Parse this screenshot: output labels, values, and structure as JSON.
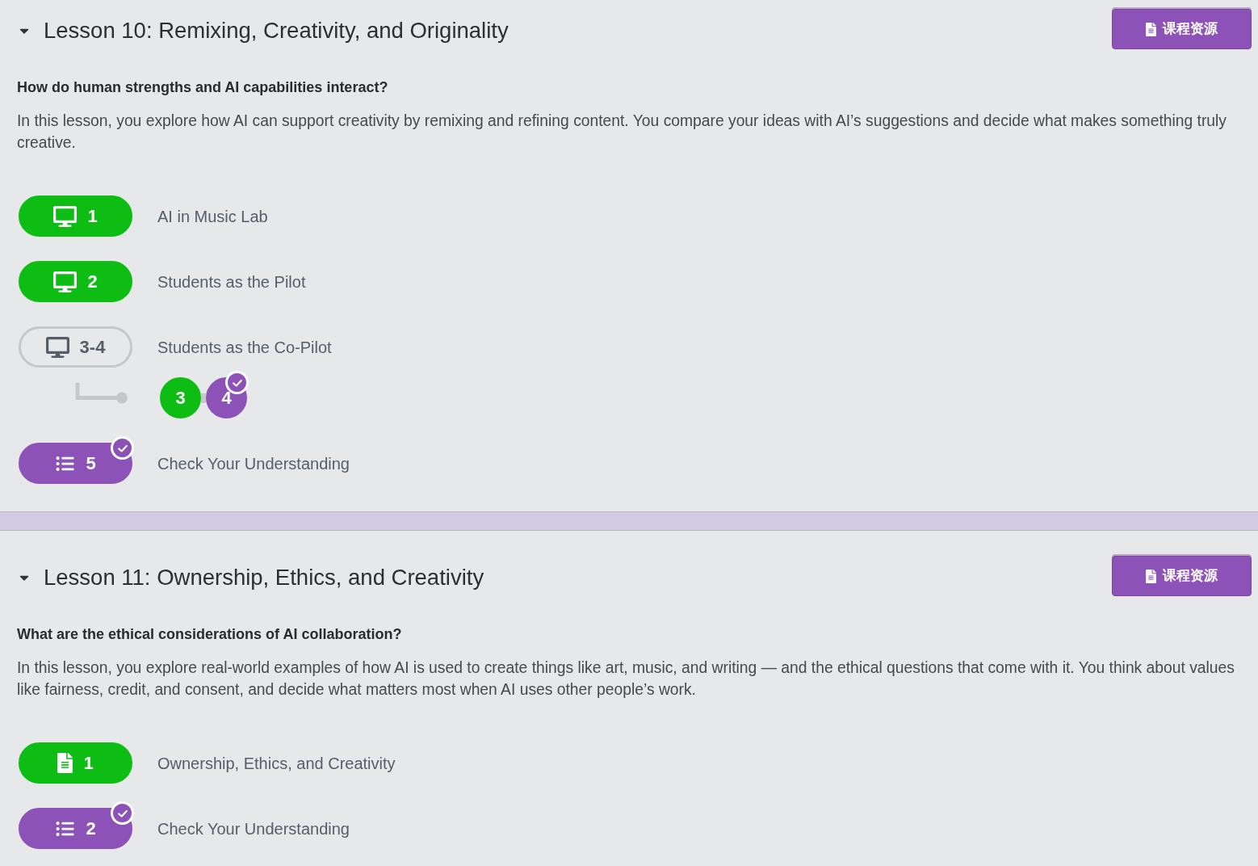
{
  "lessons": [
    {
      "title": "Lesson 10: Remixing, Creativity, and Originality",
      "expanded": true,
      "resources_button": "课程资源",
      "question": "How do human strengths and AI capabilities interact?",
      "description": "In this lesson, you explore how AI can support creativity by remixing and refining content. You compare your ideas with AI’s suggestions and decide what makes something truly creative.",
      "activities": [
        {
          "kind": "monitor",
          "label": "1",
          "title": "AI in Music Lab",
          "completed": true,
          "assessment": false,
          "checked": false
        },
        {
          "kind": "monitor",
          "label": "2",
          "title": "Students as the Pilot",
          "completed": true,
          "assessment": false,
          "checked": false
        },
        {
          "kind": "monitor",
          "label": "3-4",
          "title": "Students as the Co-Pilot",
          "completed": false,
          "assessment": false,
          "checked": false,
          "sublevels": [
            {
              "label": "3",
              "completed": true,
              "assessment": false,
              "checked": false
            },
            {
              "label": "4",
              "completed": true,
              "assessment": true,
              "checked": true
            }
          ]
        },
        {
          "kind": "list",
          "label": "5",
          "title": "Check Your Understanding",
          "completed": true,
          "assessment": true,
          "checked": true
        }
      ]
    },
    {
      "title": "Lesson 11: Ownership, Ethics, and Creativity",
      "expanded": true,
      "resources_button": "课程资源",
      "question": "What are the ethical considerations of AI collaboration?",
      "description": "In this lesson, you explore real-world examples of how AI is used to create things like art, music, and writing — and the ethical questions that come with it. You think about values like fairness, credit, and consent, and decide what matters most when AI uses other people’s work.",
      "activities": [
        {
          "kind": "document",
          "label": "1",
          "title": "Ownership, Ethics, and Creativity",
          "completed": true,
          "assessment": false,
          "checked": false
        },
        {
          "kind": "list",
          "label": "2",
          "title": "Check Your Understanding",
          "completed": true,
          "assessment": true,
          "checked": true
        }
      ]
    }
  ]
}
